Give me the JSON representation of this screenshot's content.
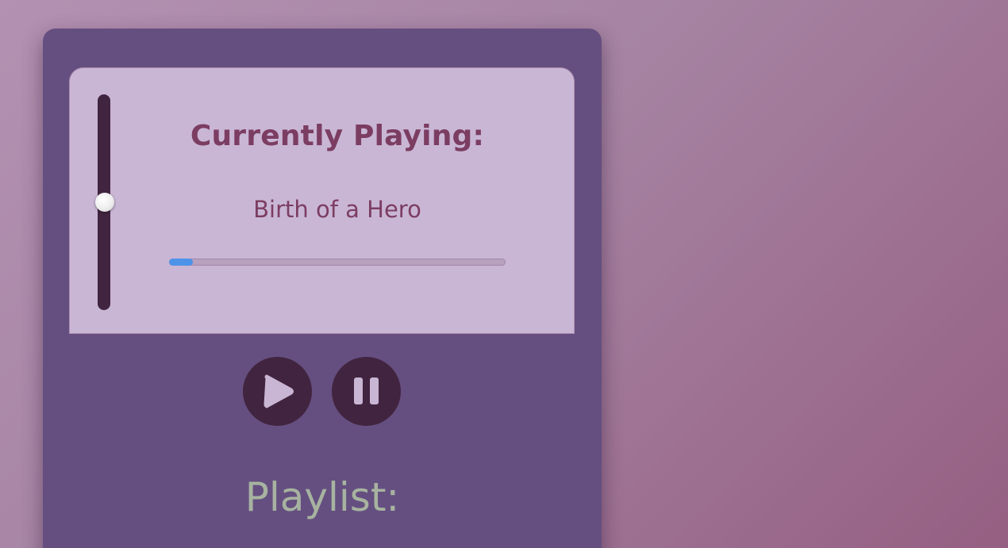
{
  "player": {
    "now_playing_label": "Currently Playing:",
    "track_title": "Birth of a Hero",
    "progress_fraction": 0.07,
    "volume_fraction": 0.5,
    "controls": {
      "play_icon": "play-icon",
      "pause_icon": "pause-icon"
    },
    "playlist_label": "Playlist:"
  },
  "colors": {
    "panel": "#654f80",
    "card": "#c9b6d5",
    "title_text": "#7c3d62",
    "control_bg": "#41243f",
    "progress_fill": "#4d93e8",
    "playlist_text": "#a7b3a0"
  }
}
